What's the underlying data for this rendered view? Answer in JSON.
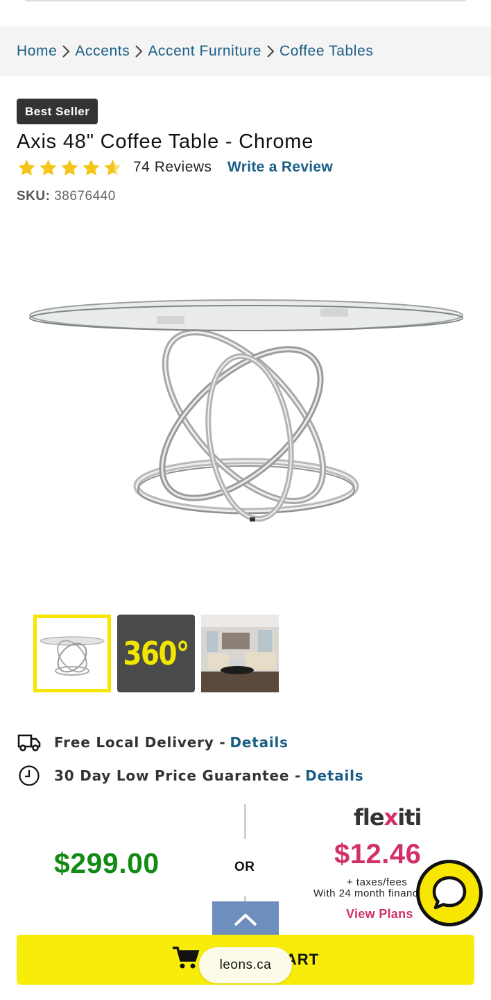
{
  "breadcrumb": [
    "Home",
    "Accents",
    "Accent Furniture",
    "Coffee Tables"
  ],
  "badge": "Best Seller",
  "product": {
    "title": "Axis 48\" Coffee Table - Chrome",
    "rating": 4.5,
    "reviews_label": "74 Reviews",
    "write_review": "Write a Review",
    "sku_label": "SKU:",
    "sku": "38676440"
  },
  "thumbnails": [
    {
      "name": "product-photo",
      "selected": true
    },
    {
      "name": "360-view",
      "text": "360°"
    },
    {
      "name": "room-scene"
    }
  ],
  "features": [
    {
      "icon": "truck-icon",
      "text": "Free Local Delivery -",
      "link": "Details"
    },
    {
      "icon": "clock-icon",
      "text": "30 Day Low Price Guarantee -",
      "link": "Details"
    }
  ],
  "pricing": {
    "price": "$299.00",
    "or": "OR",
    "financing_brand": {
      "a": "fle",
      "x": "x",
      "b": "iti"
    },
    "monthly": "$12.46",
    "taxes": "+ taxes/fees",
    "term": "With 24 month financing",
    "view_plans": "View Plans"
  },
  "cart": {
    "label": "ADD TO CART"
  },
  "url_pill": "leons.ca",
  "colors": {
    "link": "#1a5e86",
    "price": "#128a14",
    "brand_yellow": "#f7ec0a",
    "flexiti_pink": "#d1306a"
  }
}
